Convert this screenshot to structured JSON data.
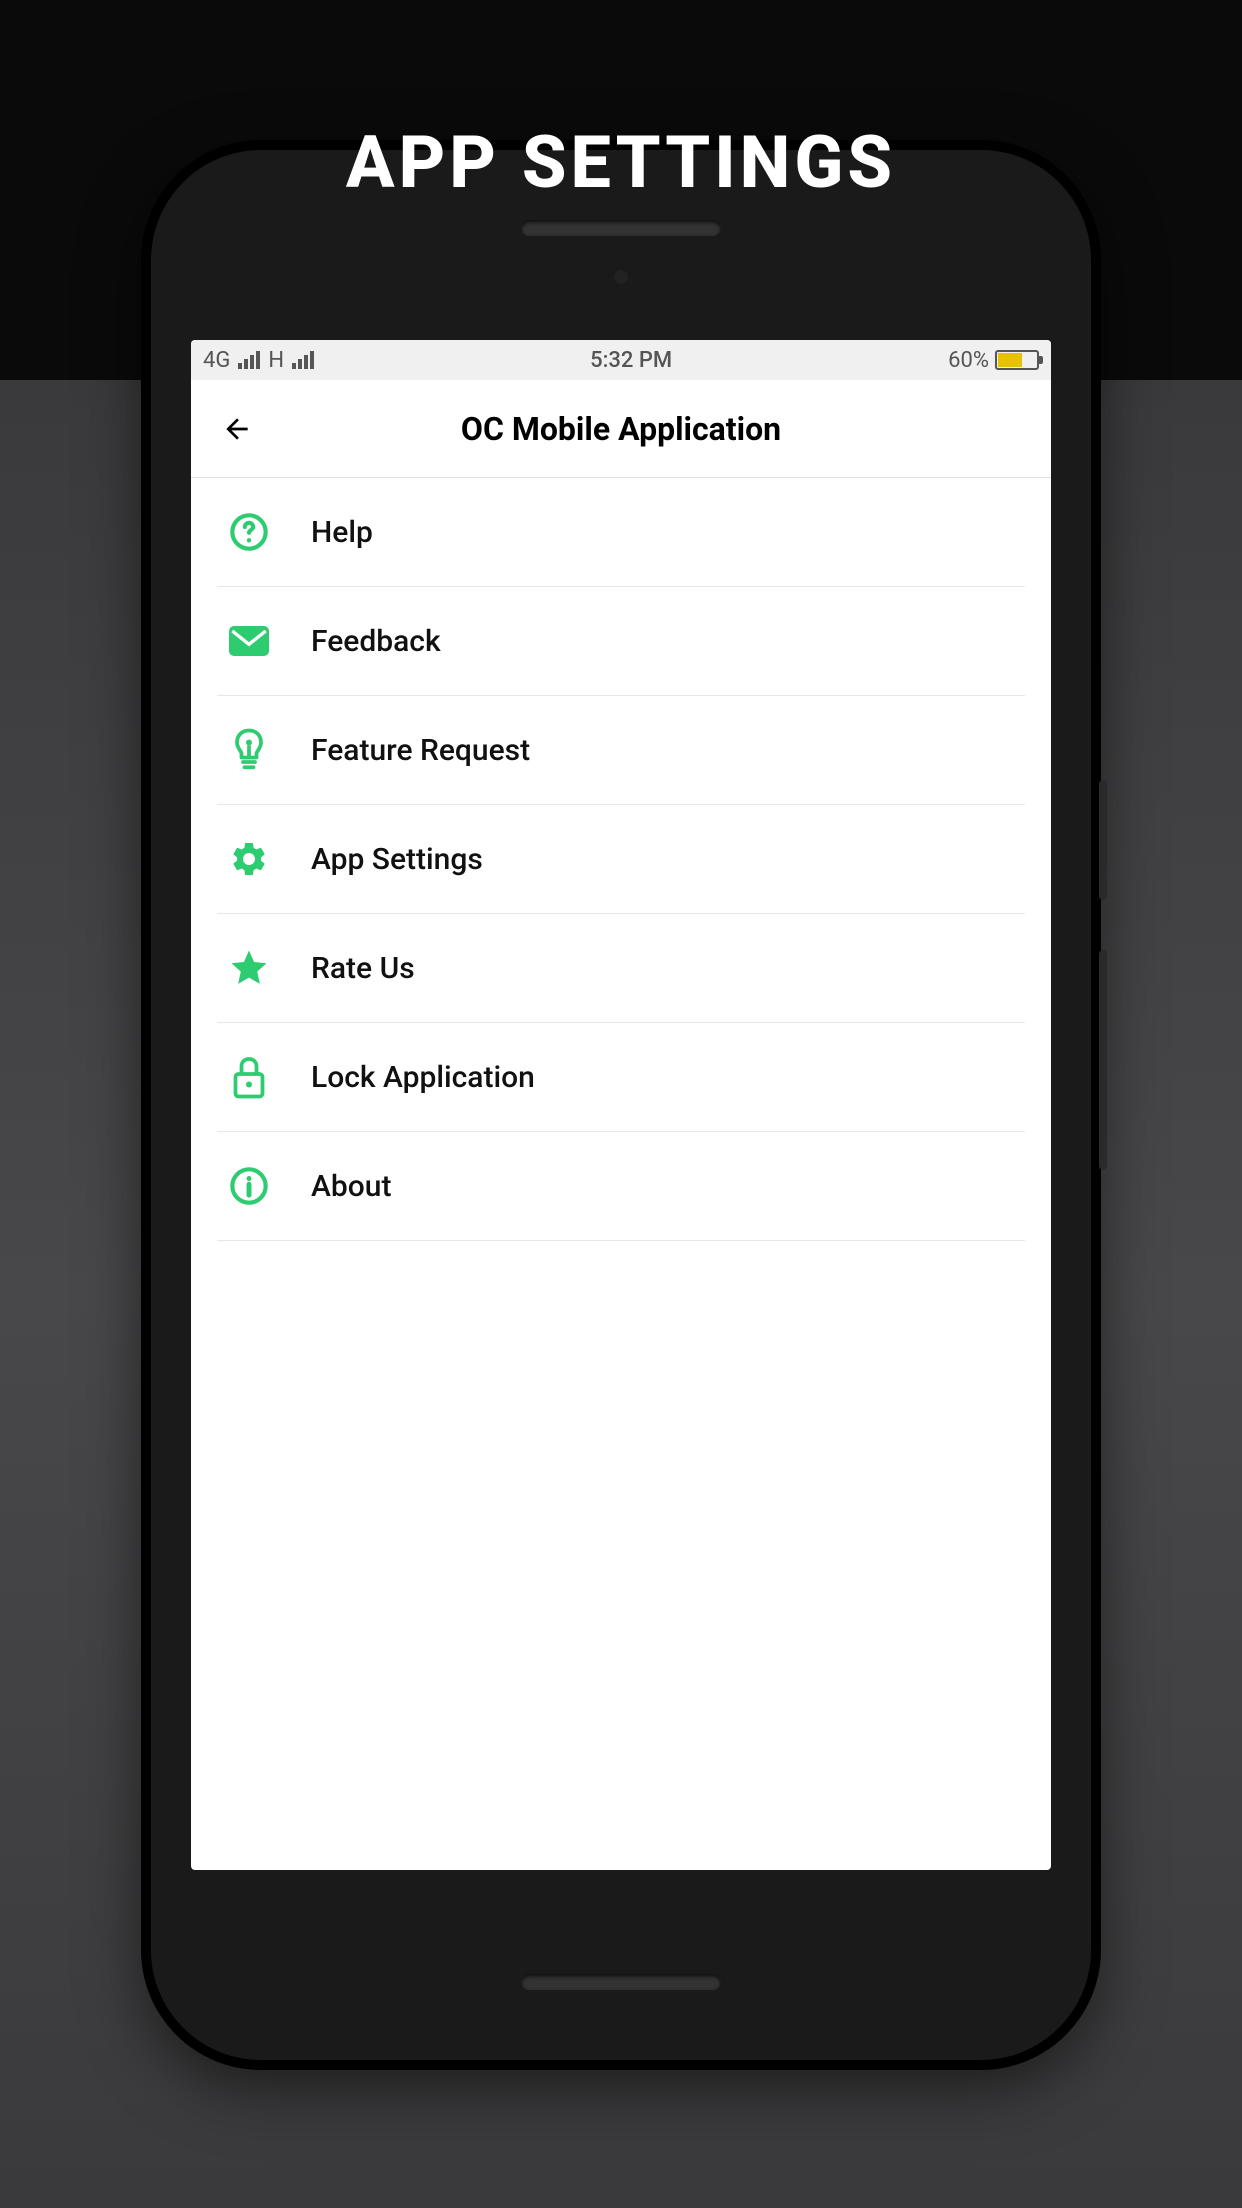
{
  "page_header": "APP SETTINGS",
  "status_bar": {
    "network": "4G",
    "network2": "H",
    "time": "5:32 PM",
    "battery_percent": "60%"
  },
  "app_header": {
    "title": "OC Mobile Application"
  },
  "menu": {
    "items": [
      {
        "label": "Help",
        "icon": "help-circle-icon"
      },
      {
        "label": "Feedback",
        "icon": "mail-icon"
      },
      {
        "label": "Feature Request",
        "icon": "lightbulb-icon"
      },
      {
        "label": "App Settings",
        "icon": "gear-icon"
      },
      {
        "label": "Rate Us",
        "icon": "star-icon"
      },
      {
        "label": "Lock Application",
        "icon": "lock-icon"
      },
      {
        "label": "About",
        "icon": "info-icon"
      }
    ]
  },
  "colors": {
    "accent": "#2ecc71"
  }
}
